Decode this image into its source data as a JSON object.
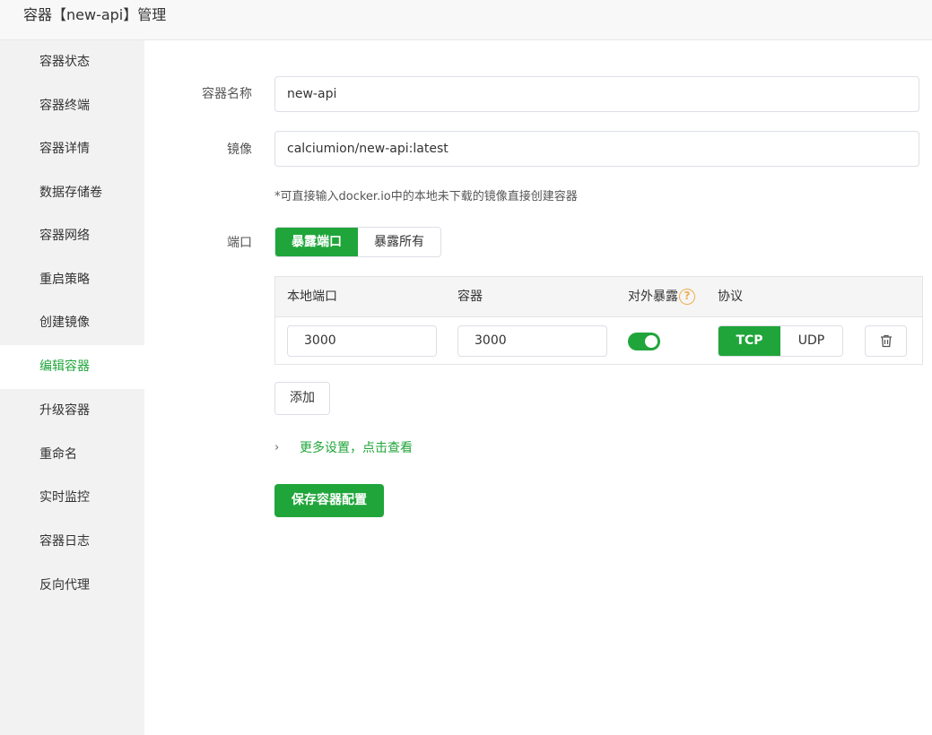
{
  "header": {
    "title": "容器【new-api】管理"
  },
  "sidebar": {
    "items": [
      {
        "label": "容器状态"
      },
      {
        "label": "容器终端"
      },
      {
        "label": "容器详情"
      },
      {
        "label": "数据存储卷"
      },
      {
        "label": "容器网络"
      },
      {
        "label": "重启策略"
      },
      {
        "label": "创建镜像"
      },
      {
        "label": "编辑容器",
        "active": true
      },
      {
        "label": "升级容器"
      },
      {
        "label": "重命名"
      },
      {
        "label": "实时监控"
      },
      {
        "label": "容器日志"
      },
      {
        "label": "反向代理"
      }
    ]
  },
  "form": {
    "name_label": "容器名称",
    "name_value": "new-api",
    "image_label": "镜像",
    "image_value": "calciumion/new-api:latest",
    "image_hint": "*可直接输入docker.io中的本地未下载的镜像直接创建容器",
    "port_label": "端口",
    "port_modes": [
      "暴露端口",
      "暴露所有"
    ],
    "port_mode_selected": "暴露端口"
  },
  "ports_table": {
    "headers": {
      "local": "本地端口",
      "container": "容器",
      "expose": "对外暴露",
      "protocol": "协议"
    },
    "help_icon": "?",
    "rows": [
      {
        "local": "3000",
        "container": "3000",
        "expose": true,
        "protocols": [
          "TCP",
          "UDP"
        ],
        "protocol_selected": "TCP"
      }
    ]
  },
  "actions": {
    "add_label": "添加",
    "more_label": "更多设置，点击查看",
    "more_chevron": "›",
    "save_label": "保存容器配置"
  },
  "colors": {
    "accent": "#20a53a",
    "warning": "#f0ad4e"
  }
}
